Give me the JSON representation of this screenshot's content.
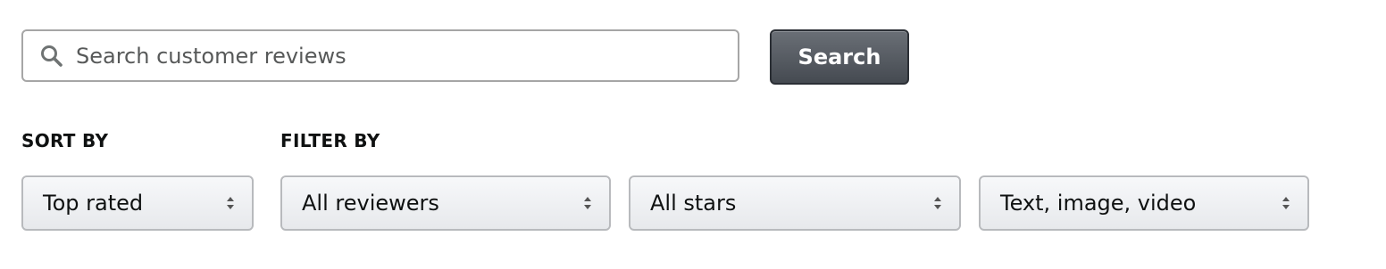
{
  "search": {
    "placeholder": "Search customer reviews",
    "button_label": "Search"
  },
  "sort": {
    "label": "SORT BY",
    "selected": "Top rated"
  },
  "filter": {
    "label": "FILTER BY",
    "reviewers_selected": "All reviewers",
    "stars_selected": "All stars",
    "media_selected": "Text, image, video"
  },
  "icons": {
    "search": "search-icon",
    "dropdown": "up-down-caret-icon"
  },
  "colors": {
    "search_button_bg": "#50555c",
    "search_button_text": "#ffffff",
    "dropdown_bg": "#eeeff2",
    "border": "#a6a6a6"
  }
}
